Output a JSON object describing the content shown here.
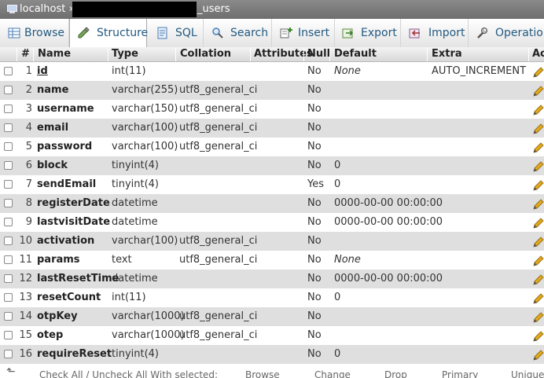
{
  "breadcrumb": {
    "server": "localhost »",
    "table_suffix": "_users"
  },
  "tabs": [
    {
      "label": "Browse",
      "icon": "browse-icon"
    },
    {
      "label": "Structure",
      "icon": "structure-icon"
    },
    {
      "label": "SQL",
      "icon": "sql-icon"
    },
    {
      "label": "Search",
      "icon": "search-icon"
    },
    {
      "label": "Insert",
      "icon": "insert-icon"
    },
    {
      "label": "Export",
      "icon": "export-icon"
    },
    {
      "label": "Import",
      "icon": "import-icon"
    },
    {
      "label": "Operation",
      "icon": "operations-icon"
    }
  ],
  "columns": {
    "num": "#",
    "name": "Name",
    "type": "Type",
    "collation": "Collation",
    "attributes": "Attributes",
    "null": "Null",
    "default": "Default",
    "extra": "Extra",
    "action": "Ac"
  },
  "rows": [
    {
      "num": "1",
      "name": "id",
      "type": "int(11)",
      "collation": "",
      "null": "No",
      "default": "None",
      "extra": "AUTO_INCREMENT"
    },
    {
      "num": "2",
      "name": "name",
      "type": "varchar(255)",
      "collation": "utf8_general_ci",
      "null": "No",
      "default": "",
      "extra": ""
    },
    {
      "num": "3",
      "name": "username",
      "type": "varchar(150)",
      "collation": "utf8_general_ci",
      "null": "No",
      "default": "",
      "extra": ""
    },
    {
      "num": "4",
      "name": "email",
      "type": "varchar(100)",
      "collation": "utf8_general_ci",
      "null": "No",
      "default": "",
      "extra": ""
    },
    {
      "num": "5",
      "name": "password",
      "type": "varchar(100)",
      "collation": "utf8_general_ci",
      "null": "No",
      "default": "",
      "extra": ""
    },
    {
      "num": "6",
      "name": "block",
      "type": "tinyint(4)",
      "collation": "",
      "null": "No",
      "default": "0",
      "extra": ""
    },
    {
      "num": "7",
      "name": "sendEmail",
      "type": "tinyint(4)",
      "collation": "",
      "null": "Yes",
      "default": "0",
      "extra": ""
    },
    {
      "num": "8",
      "name": "registerDate",
      "type": "datetime",
      "collation": "",
      "null": "No",
      "default": "0000-00-00 00:00:00",
      "extra": ""
    },
    {
      "num": "9",
      "name": "lastvisitDate",
      "type": "datetime",
      "collation": "",
      "null": "No",
      "default": "0000-00-00 00:00:00",
      "extra": ""
    },
    {
      "num": "10",
      "name": "activation",
      "type": "varchar(100)",
      "collation": "utf8_general_ci",
      "null": "No",
      "default": "",
      "extra": ""
    },
    {
      "num": "11",
      "name": "params",
      "type": "text",
      "collation": "utf8_general_ci",
      "null": "No",
      "default": "None",
      "extra": ""
    },
    {
      "num": "12",
      "name": "lastResetTime",
      "type": "datetime",
      "collation": "",
      "null": "No",
      "default": "0000-00-00 00:00:00",
      "extra": ""
    },
    {
      "num": "13",
      "name": "resetCount",
      "type": "int(11)",
      "collation": "",
      "null": "No",
      "default": "0",
      "extra": ""
    },
    {
      "num": "14",
      "name": "otpKey",
      "type": "varchar(1000)",
      "collation": "utf8_general_ci",
      "null": "No",
      "default": "",
      "extra": ""
    },
    {
      "num": "15",
      "name": "otep",
      "type": "varchar(1000)",
      "collation": "utf8_general_ci",
      "null": "No",
      "default": "",
      "extra": ""
    },
    {
      "num": "16",
      "name": "requireReset",
      "type": "tinyint(4)",
      "collation": "",
      "null": "No",
      "default": "0",
      "extra": ""
    }
  ],
  "footer": {
    "check_all": "Check All / Uncheck All With selected:",
    "a1": "Browse",
    "a2": "Change",
    "a3": "Drop",
    "a4": "Primary",
    "a5": "Unique"
  },
  "colors": {
    "tab_text": "#235a81",
    "row_even": "#dfdfdf",
    "pencil": "#e0a81c"
  }
}
